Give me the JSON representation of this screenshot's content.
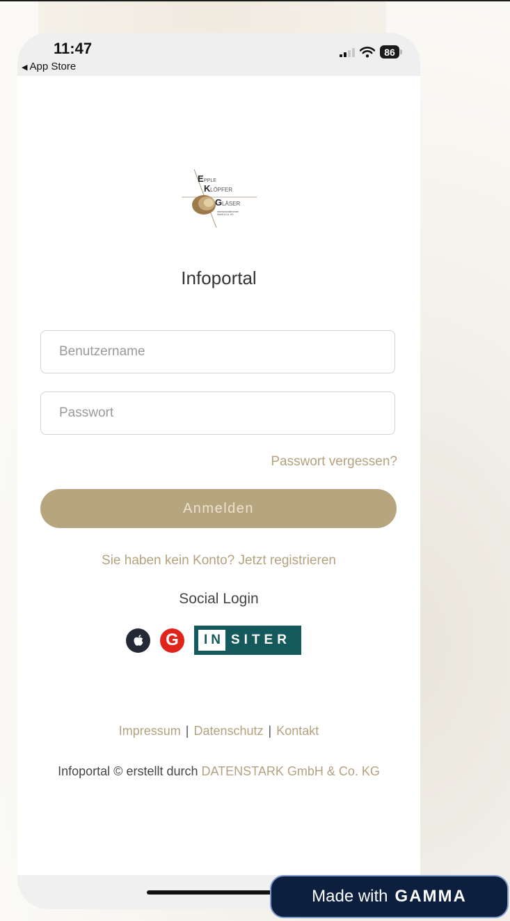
{
  "status_bar": {
    "time": "11:47",
    "back_label": "App Store",
    "battery": "86"
  },
  "logo": {
    "line1": "EPPLE",
    "line2": "KLÖPFER",
    "line3": "GLÄSER",
    "line4": "mineral-fondsbrunnen",
    "line5": "GmbH & Co. KG"
  },
  "title": "Infoportal",
  "form": {
    "username_placeholder": "Benutzername",
    "password_placeholder": "Passwort",
    "forgot_label": "Passwort vergessen?",
    "login_label": "Anmelden"
  },
  "register_label": "Sie haben kein Konto? Jetzt registrieren",
  "social": {
    "title": "Social Login",
    "google_letter": "G",
    "insiter_box": "IN",
    "insiter_rest": "SITER"
  },
  "footer": {
    "impressum": "Impressum",
    "datenschutz": "Datenschutz",
    "kontakt": "Kontakt",
    "separator": "|",
    "credits_prefix": "Infoportal © erstellt durch ",
    "credits_company": "DATENSTARK GmbH & Co. KG"
  },
  "badge": {
    "prefix": "Made with",
    "brand": "GAMMA"
  },
  "colors": {
    "accent": "#b7a580",
    "link": "#b4a27f",
    "insiter": "#14595c",
    "badge": "#0c1f3f"
  },
  "icons": [
    "back-arrow-icon",
    "signal-icon",
    "wifi-icon",
    "battery-icon",
    "apple-icon",
    "google-icon",
    "insiter-logo"
  ]
}
